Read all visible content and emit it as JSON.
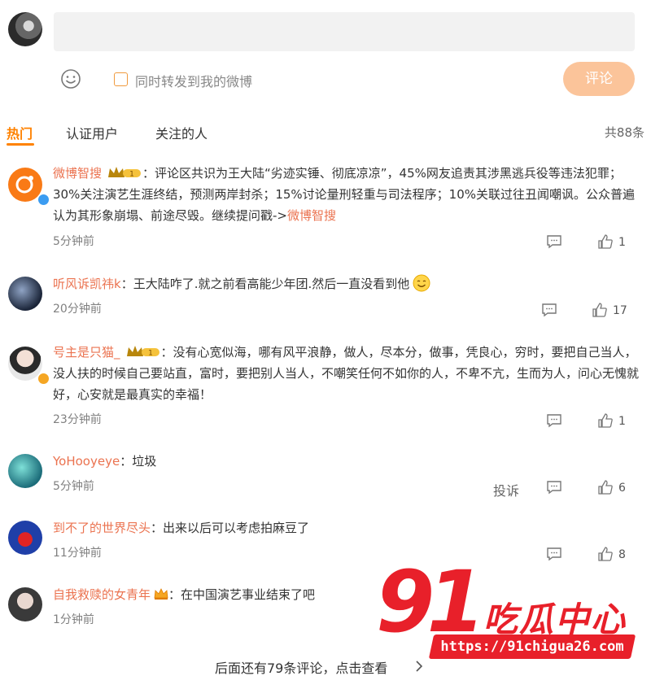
{
  "composer": {
    "placeholder": "",
    "repost_label": "同时转发到我的微博",
    "submit_label": "评论"
  },
  "tabs": [
    {
      "label": "热门",
      "active": true
    },
    {
      "label": "认证用户",
      "active": false
    },
    {
      "label": "关注的人",
      "active": false
    }
  ],
  "total_count": "共88条",
  "comments": [
    {
      "user": "微博智搜",
      "text": "：评论区共识为王大陆“劣迹实锤、彻底凉凉”，45%网友追责其涉黑逃兵役等违法犯罪；30%关注演艺生涯终结，预测两岸封杀；15%讨论量刑轻重与司法程序；10%关联过往丑闻嘲讽。公众普遍认为其形象崩塌、前途尽毁。继续提问戳->",
      "link": "微博智搜",
      "time": "5分钟前",
      "likes": "1"
    },
    {
      "user": "听风诉凯祎k",
      "text": "：王大陆咋了.就之前看高能少年团.然后一直没看到他",
      "time": "20分钟前",
      "likes": "17"
    },
    {
      "user": "号主是只猫_",
      "text": "：没有心宽似海，哪有风平浪静，做人，尽本分，做事，凭良心，穷时，要把自己当人，没人扶的时候自己要站直，富时，要把别人当人，不嘲笑任何不如你的人，不卑不亢，生而为人，问心无愧就好，心安就是最真实的幸福！",
      "time": "23分钟前",
      "likes": "1"
    },
    {
      "user": "YoHooyeye",
      "text": "：垃圾",
      "time": "5分钟前",
      "report": "投诉",
      "likes": "6"
    },
    {
      "user": "到不了的世界尽头",
      "text": "：出来以后可以考虑拍麻豆了",
      "time": "11分钟前",
      "likes": "8"
    },
    {
      "user": "自我救赎的女青年",
      "text": "：在中国演艺事业结束了吧",
      "time": "1分钟前"
    }
  ],
  "more_link": "后面还有79条评论，点击查看",
  "watermark": {
    "number": "91",
    "title": "吃瓜中心",
    "url": "https://91chigua26.com"
  },
  "colors": {
    "accent": "#ff8200",
    "username": "#eb7350",
    "submit_disabled": "#fbc49a",
    "watermark_red": "#e8202a"
  },
  "icons": [
    "smiley-icon",
    "checkbox-icon",
    "reply-icon",
    "like-icon",
    "vip-crown-badge",
    "verified-badge",
    "smile-emoji",
    "chevron-right-icon"
  ]
}
